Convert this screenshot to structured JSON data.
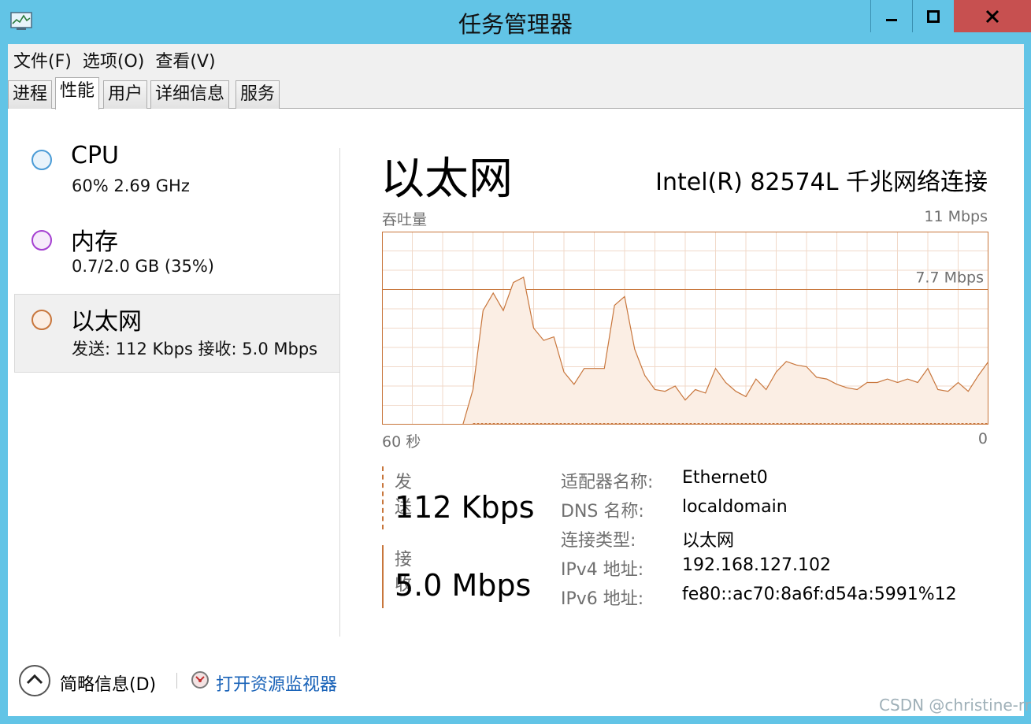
{
  "window": {
    "title": "任务管理器"
  },
  "menu": [
    "文件(F)",
    "选项(O)",
    "查看(V)"
  ],
  "tabs": [
    "进程",
    "性能",
    "用户",
    "详细信息",
    "服务"
  ],
  "sidebar": [
    {
      "title": "CPU",
      "sub": "60%  2.69 GHz",
      "color": "#4a9bd6"
    },
    {
      "title": "内存",
      "sub": "0.7/2.0 GB (35%)",
      "color": "#a43fd1"
    },
    {
      "title": "以太网",
      "sub": "发送: 112 Kbps  接收: 5.0 Mbps",
      "color": "#c8763c"
    }
  ],
  "main": {
    "title": "以太网",
    "adapter": "Intel(R) 82574L 千兆网络连接",
    "throughput_label": "吞吐量",
    "max_label": "11 Mbps",
    "mid_label": "7.7 Mbps",
    "time_label": "60 秒",
    "zero_label": "0"
  },
  "chart_data": {
    "type": "area",
    "ylim": [
      0,
      11
    ],
    "x": [
      60,
      59,
      58,
      57,
      56,
      55,
      54,
      53,
      52,
      51,
      50,
      49,
      48,
      47,
      46,
      45,
      44,
      43,
      42,
      41,
      40,
      39,
      38,
      37,
      36,
      35,
      34,
      33,
      32,
      31,
      30,
      29,
      28,
      27,
      26,
      25,
      24,
      23,
      22,
      21,
      20,
      19,
      18,
      17,
      16,
      15,
      14,
      13,
      12,
      11,
      10,
      9,
      8,
      7,
      6,
      5,
      4,
      3,
      2,
      1,
      0
    ],
    "series": [
      {
        "values": [
          0,
          0,
          0,
          0,
          0,
          0,
          0,
          0,
          0,
          2.0,
          6.5,
          7.5,
          6.5,
          8.1,
          8.4,
          5.5,
          4.8,
          5.0,
          3.0,
          2.3,
          3.2,
          3.2,
          3.2,
          6.8,
          7.3,
          4.3,
          2.8,
          2.0,
          1.9,
          2.2,
          1.4,
          2.0,
          1.8,
          3.2,
          2.4,
          1.9,
          1.6,
          2.6,
          2.0,
          3.0,
          3.6,
          3.4,
          3.3,
          2.7,
          2.6,
          2.3,
          2.1,
          2.0,
          2.4,
          2.4,
          2.6,
          2.4,
          2.6,
          2.4,
          3.2,
          2.0,
          1.9,
          2.4,
          1.9,
          2.8,
          3.6
        ]
      }
    ],
    "grid": true
  },
  "send": {
    "label": "发送",
    "value": "112 Kbps"
  },
  "receive": {
    "label": "接收",
    "value": "5.0 Mbps"
  },
  "info": [
    {
      "key": "适配器名称:",
      "value": "Ethernet0"
    },
    {
      "key": "DNS 名称:",
      "value": "localdomain"
    },
    {
      "key": "连接类型:",
      "value": "以太网"
    },
    {
      "key": "IPv4 地址:",
      "value": "192.168.127.102"
    },
    {
      "key": "IPv6 地址:",
      "value": "fe80::ac70:8a6f:d54a:5991%12"
    }
  ],
  "footer": {
    "summary": "简略信息(D)",
    "monitor_link": "打开资源监视器"
  },
  "watermark": "CSDN @christine-rr",
  "colors": {
    "accent": "#c8763c",
    "fill": "#fbeee4",
    "titlebar": "#62c4e6"
  }
}
